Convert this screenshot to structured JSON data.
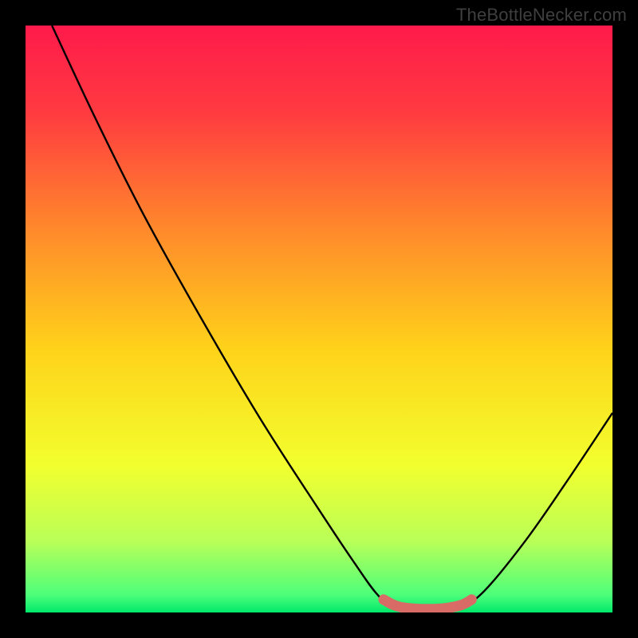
{
  "watermark": "TheBottleNecker.com",
  "chart_data": {
    "type": "line",
    "title": "",
    "xlabel": "",
    "ylabel": "",
    "xlim": [
      0,
      1000
    ],
    "ylim": [
      0,
      1000
    ],
    "grid": false,
    "legend": false,
    "background": {
      "type": "vertical-gradient",
      "stops": [
        {
          "offset": 0.0,
          "color": "#ff1a4b"
        },
        {
          "offset": 0.15,
          "color": "#ff3b40"
        },
        {
          "offset": 0.35,
          "color": "#ff8a2b"
        },
        {
          "offset": 0.55,
          "color": "#ffd21a"
        },
        {
          "offset": 0.75,
          "color": "#f2ff2e"
        },
        {
          "offset": 0.88,
          "color": "#b8ff58"
        },
        {
          "offset": 0.97,
          "color": "#4dff7a"
        },
        {
          "offset": 1.0,
          "color": "#00e86b"
        }
      ]
    },
    "series": [
      {
        "name": "bottleneck-curve",
        "color": "#000000",
        "width": 2.4,
        "points": [
          {
            "x": 45,
            "y": 1000
          },
          {
            "x": 120,
            "y": 840
          },
          {
            "x": 200,
            "y": 680
          },
          {
            "x": 300,
            "y": 500
          },
          {
            "x": 400,
            "y": 330
          },
          {
            "x": 500,
            "y": 175
          },
          {
            "x": 560,
            "y": 85
          },
          {
            "x": 600,
            "y": 30
          },
          {
            "x": 630,
            "y": 8
          },
          {
            "x": 700,
            "y": 5
          },
          {
            "x": 740,
            "y": 10
          },
          {
            "x": 780,
            "y": 35
          },
          {
            "x": 850,
            "y": 120
          },
          {
            "x": 920,
            "y": 220
          },
          {
            "x": 1000,
            "y": 340
          }
        ]
      },
      {
        "name": "optimal-range-marker",
        "color": "#d96b66",
        "width": 13,
        "linecap": "round",
        "points": [
          {
            "x": 610,
            "y": 22
          },
          {
            "x": 640,
            "y": 9
          },
          {
            "x": 700,
            "y": 6
          },
          {
            "x": 740,
            "y": 12
          },
          {
            "x": 760,
            "y": 22
          }
        ]
      }
    ]
  }
}
